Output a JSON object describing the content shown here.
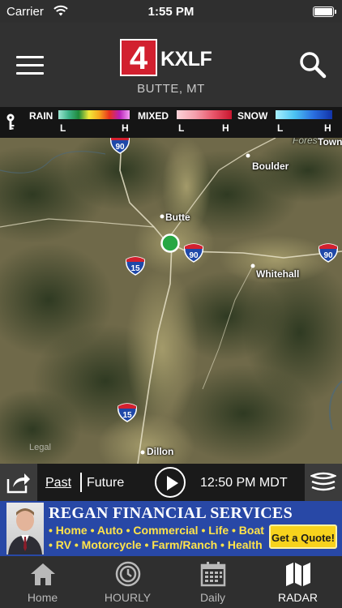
{
  "status_bar": {
    "carrier": "Carrier",
    "time": "1:55 PM"
  },
  "header": {
    "logo_number": "4",
    "logo_call": "KXLF",
    "location": "BUTTE, MT"
  },
  "legend": {
    "rain": "RAIN",
    "mixed": "MIXED",
    "snow": "SNOW",
    "low": "L",
    "high": "H"
  },
  "map": {
    "towns": {
      "boulder": "Boulder",
      "butte": "Butte",
      "whitehall": "Whitehall",
      "dillon": "Dillon",
      "town_partial": "Town",
      "forest_partial": "Fores"
    },
    "interstates": {
      "i90_top": "90",
      "i90_center": "90",
      "i90_right": "90",
      "i15_mid": "15",
      "i15_south": "15"
    },
    "legal": "Legal"
  },
  "playback": {
    "past": "Past",
    "future": "Future",
    "timestamp": "12:50 PM MDT"
  },
  "ad": {
    "title": "REGAN FINANCIAL SERVICES",
    "line1": "• Home • Auto • Commercial • Life • Boat",
    "line2": "• RV • Motorcycle • Farm/Ranch • Health",
    "cta": "Get a Quote!"
  },
  "tabs": {
    "home": "Home",
    "hourly": "HOURLY",
    "daily": "Daily",
    "radar": "RADAR"
  },
  "colors": {
    "logo_red": "#d2202f",
    "ad_blue": "#2848a6",
    "ad_yellow": "#ffe34a",
    "location_marker": "#27a744",
    "active_tab": "#ffffff"
  }
}
